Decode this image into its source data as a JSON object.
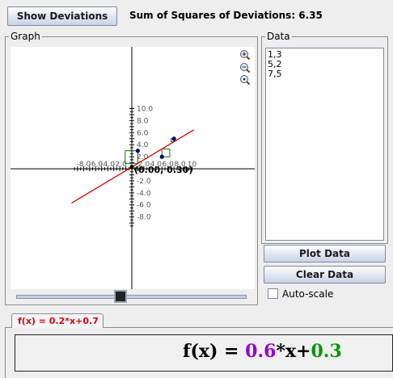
{
  "toolbar": {
    "show_deviations_label": "Show Deviations",
    "ss_label": "Sum of Squares of Deviations: 6.35"
  },
  "graph": {
    "title": "Graph",
    "origin_label": "(0.00, 0.30)",
    "x_tick_labels": [
      "-8.0",
      "-6.0",
      "-4.0",
      "-2.0",
      "2.0",
      "4.0",
      "6.0",
      "8.0",
      "10"
    ],
    "y_tick_labels": [
      "10.0",
      "8.0",
      "6.0",
      "4.0",
      "2.0",
      "-2.0",
      "-4.0",
      "-6.0",
      "-8.0"
    ],
    "zoom_in_icon": "zoom-in-icon",
    "zoom_out_icon": "zoom-out-icon",
    "zoom_reset_icon": "zoom-reset-icon"
  },
  "data_panel": {
    "title": "Data",
    "text": "1,3\n5,2\n7,5",
    "plot_label": "Plot Data",
    "clear_label": "Clear Data",
    "autoscale_label": "Auto-scale",
    "autoscale_checked": false
  },
  "slider": {
    "value": 0.45
  },
  "function_tab": {
    "label": "f(x) = 0.2*x+0.7"
  },
  "formula": {
    "prefix": "f(x) = ",
    "slope": "0.6",
    "middle": "*x+",
    "intercept": "0.3"
  },
  "chart_data": {
    "type": "scatter",
    "x_range": [
      -10,
      10
    ],
    "y_range": [
      -10,
      10
    ],
    "points": [
      {
        "x": 1,
        "y": 3
      },
      {
        "x": 5,
        "y": 2
      },
      {
        "x": 7,
        "y": 5
      }
    ],
    "line": {
      "slope": 0.6,
      "intercept": 0.3
    },
    "colors": {
      "line": "#dd0000",
      "points": "#000080",
      "deviation_boxes": "#008000"
    }
  }
}
